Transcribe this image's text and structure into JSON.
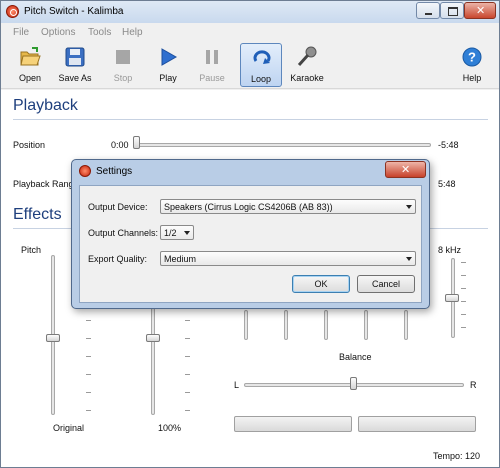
{
  "window": {
    "title": "Pitch Switch - Kalimba"
  },
  "menu": [
    "File",
    "Options",
    "Tools",
    "Help"
  ],
  "toolbar": [
    {
      "label": "Open",
      "icon": "folder-open-icon",
      "enabled": true
    },
    {
      "label": "Save As",
      "icon": "floppy-disk-icon",
      "enabled": true
    },
    {
      "label": "Stop",
      "icon": "stop-icon",
      "enabled": false
    },
    {
      "label": "Play",
      "icon": "play-icon",
      "enabled": true
    },
    {
      "label": "Pause",
      "icon": "pause-icon",
      "enabled": false
    },
    {
      "label": "Loop",
      "icon": "loop-icon",
      "enabled": true,
      "active": true
    },
    {
      "label": "Karaoke",
      "icon": "microphone-icon",
      "enabled": true
    },
    {
      "label": "Help",
      "icon": "help-icon",
      "enabled": true
    }
  ],
  "playback": {
    "title": "Playback",
    "position_label": "Position",
    "position_time": "0:00",
    "position_remaining": "-5:48",
    "range_label": "Playback Range",
    "range_end": "5:48"
  },
  "effects": {
    "title": "Effects",
    "pitch_label": "Pitch",
    "pitch_value": "Original",
    "tempo_value": "100%",
    "eq_label": "8 kHz",
    "balance_label": "Balance",
    "balance_left": "L",
    "balance_right": "R",
    "status_tempo": "Tempo: 120"
  },
  "dialog": {
    "title": "Settings",
    "output_device_label": "Output Device:",
    "output_device_value": "Speakers (Cirrus Logic CS4206B (AB 83))",
    "output_channels_label": "Output Channels:",
    "output_channels_value": "1/2",
    "export_quality_label": "Export Quality:",
    "export_quality_value": "Medium",
    "ok_label": "OK",
    "cancel_label": "Cancel"
  }
}
